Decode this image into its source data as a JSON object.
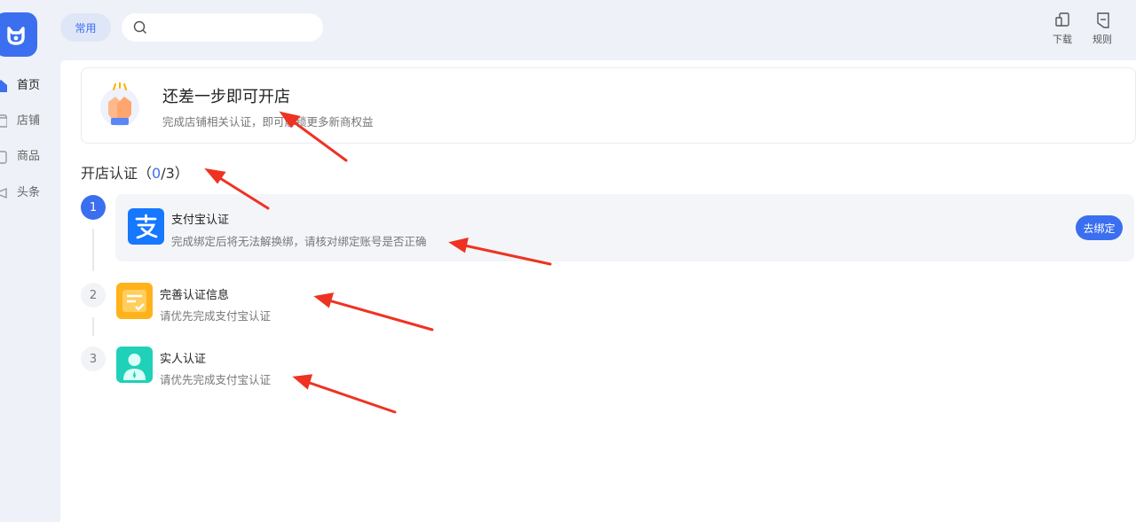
{
  "sidebar": {
    "items": [
      {
        "label": "首页",
        "icon": "home-icon"
      },
      {
        "label": "店铺",
        "icon": "store-icon"
      },
      {
        "label": "商品",
        "icon": "product-icon"
      },
      {
        "label": "头条",
        "icon": "headline-icon"
      }
    ]
  },
  "topbar": {
    "chip_label": "常用",
    "search": {
      "value": "",
      "placeholder": ""
    },
    "actions": [
      {
        "label": "下载",
        "icon": "download-icon"
      },
      {
        "label": "规则",
        "icon": "rules-icon"
      }
    ]
  },
  "banner": {
    "title": "还差一步即可开店",
    "subtitle": "完成店铺相关认证，即可解锁更多新商权益"
  },
  "section": {
    "title_prefix": "开店认证（",
    "done": "0",
    "total_suffix": "/3）"
  },
  "steps": [
    {
      "num": "1",
      "title": "支付宝认证",
      "subtitle": "完成绑定后将无法解换绑，请核对绑定账号是否正确",
      "button": "去绑定",
      "icon": "alipay-icon"
    },
    {
      "num": "2",
      "title": "完善认证信息",
      "subtitle": "请优先完成支付宝认证",
      "icon": "info-form-icon"
    },
    {
      "num": "3",
      "title": "实人认证",
      "subtitle": "请优先完成支付宝认证",
      "icon": "person-verify-icon"
    }
  ],
  "colors": {
    "accent": "#3b6ff0",
    "annotation": "#ee3322",
    "alipay": "#1677ff",
    "orange": "#ffb21a",
    "teal": "#1fd1b8"
  }
}
